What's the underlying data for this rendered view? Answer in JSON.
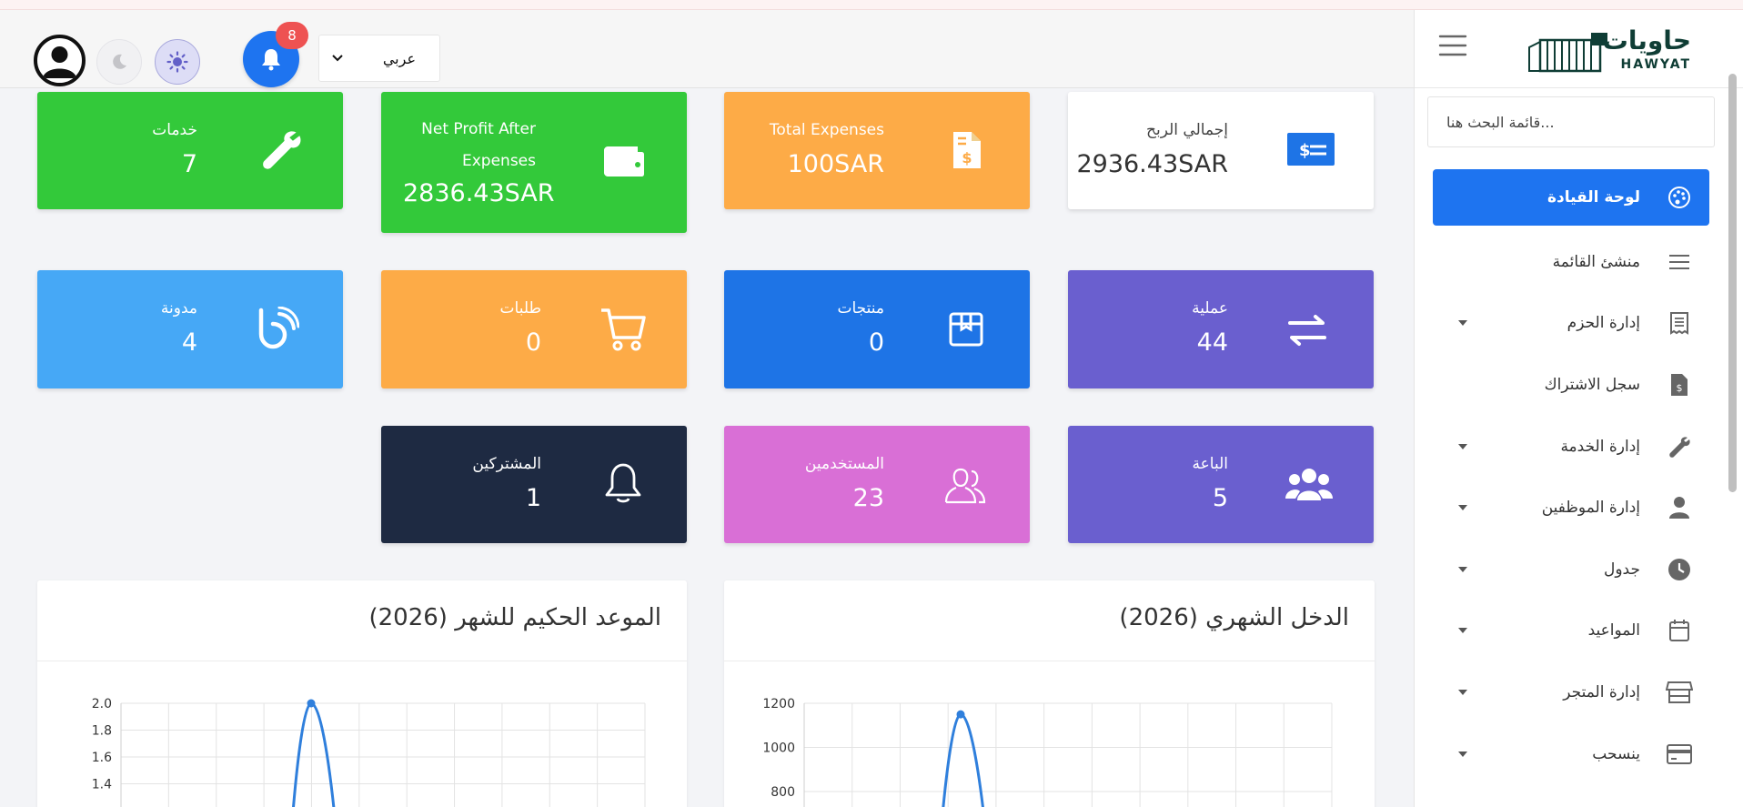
{
  "header": {
    "notifications_count": "8",
    "language": "عربي",
    "theme_icons": [
      "moon-icon",
      "sun-icon"
    ],
    "notification_icon": "bell-icon"
  },
  "sidebar": {
    "brand_ar": "حاويات",
    "brand_en": "HAWYAT",
    "search_placeholder": "...قائمة البحث هنا",
    "items": [
      {
        "label": "لوحة القيادة",
        "icon": "palette-icon",
        "active": true,
        "has_caret": false
      },
      {
        "label": "منشئ القائمة",
        "icon": "list-icon",
        "active": false,
        "has_caret": false
      },
      {
        "label": "إدارة الحزم",
        "icon": "receipt-icon",
        "active": false,
        "has_caret": true
      },
      {
        "label": "سجل الاشتراك",
        "icon": "invoice-icon",
        "active": false,
        "has_caret": false
      },
      {
        "label": "إدارة الخدمة",
        "icon": "wrench-icon",
        "active": false,
        "has_caret": true
      },
      {
        "label": "إدارة الموظفين",
        "icon": "user-icon",
        "active": false,
        "has_caret": true
      },
      {
        "label": "جدول",
        "icon": "clock-icon",
        "active": false,
        "has_caret": true
      },
      {
        "label": "المواعيد",
        "icon": "calendar-icon",
        "active": false,
        "has_caret": true
      },
      {
        "label": "إدارة المتجر",
        "icon": "store-icon",
        "active": false,
        "has_caret": true
      },
      {
        "label": "ينسحب",
        "icon": "credit-card-icon",
        "active": false,
        "has_caret": true
      }
    ]
  },
  "cards": [
    {
      "label": "إجمالي الربح",
      "value": "2936.43SAR",
      "icon": "money-bill-icon",
      "bg": "#ffffff"
    },
    {
      "label": "Total Expenses",
      "value": "100SAR",
      "icon": "invoice-dollar-icon",
      "bg": "#fdab47"
    },
    {
      "label": "Net Profit After Expenses",
      "value": "2836.43SAR",
      "icon": "wallet-icon",
      "bg": "#33c93a"
    },
    {
      "label": "خدمات",
      "value": "7",
      "icon": "wrench-icon",
      "bg": "#33c93a"
    },
    {
      "label": "عملية",
      "value": "44",
      "icon": "exchange-icon",
      "bg": "#6a5fcf"
    },
    {
      "label": "منتجات",
      "value": "0",
      "icon": "box-icon",
      "bg": "#1e74e6"
    },
    {
      "label": "طلبات",
      "value": "0",
      "icon": "cart-icon",
      "bg": "#fdab47"
    },
    {
      "label": "مدونة",
      "value": "4",
      "icon": "blog-icon",
      "bg": "#46a8f6"
    },
    {
      "label": "الباعة",
      "value": "5",
      "icon": "users-icon",
      "bg": "#6a5fcf"
    },
    {
      "label": "المستخدمين",
      "value": "23",
      "icon": "user-friends-icon",
      "bg": "#d96fd6"
    },
    {
      "label": "المشتركين",
      "value": "1",
      "icon": "bell-icon",
      "bg": "#1e2a42"
    }
  ],
  "chart_data": [
    {
      "type": "line",
      "title": "الدخل الشهري (2026)",
      "y_ticks": [
        "1200",
        "1000",
        "800"
      ],
      "ylim": [
        0,
        1200
      ],
      "peak_value": 1150
    },
    {
      "type": "line",
      "title": "الموعد الحكيم للشهر (2026)",
      "y_ticks": [
        "2.0",
        "1.8",
        "1.6",
        "1.4"
      ],
      "ylim": [
        0,
        2.0
      ],
      "peak_value": 2.0
    }
  ]
}
